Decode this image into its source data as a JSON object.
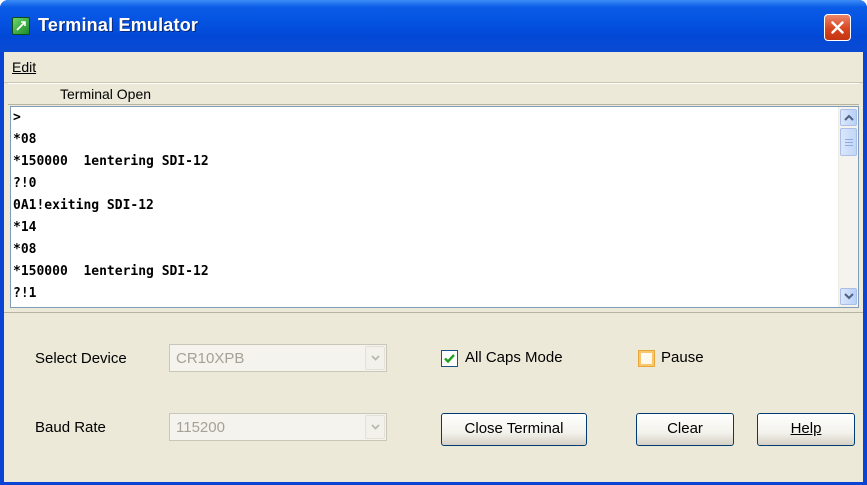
{
  "window": {
    "title": "Terminal Emulator"
  },
  "menu": {
    "edit_label": "Edit"
  },
  "status": {
    "text": "Terminal Open"
  },
  "terminal": {
    "lines": [
      ">",
      "*08",
      "*150000  1entering SDI-12",
      "?!0",
      "0A1!exiting SDI-12",
      "*14",
      "*08",
      "*150000  1entering SDI-12",
      "?!1"
    ]
  },
  "controls": {
    "select_device_label": "Select Device",
    "select_device_value": "CR10XPB",
    "baud_rate_label": "Baud Rate",
    "baud_rate_value": "115200",
    "all_caps_label": "All Caps Mode",
    "all_caps_checked": true,
    "pause_label": "Pause",
    "pause_checked": false,
    "close_terminal_label": "Close Terminal",
    "clear_label": "Clear",
    "help_label": "Help"
  },
  "colors": {
    "titlebar": "#0553e2",
    "close_button": "#d8451f",
    "panel": "#ece9d8",
    "check_mark": "#21a121"
  }
}
